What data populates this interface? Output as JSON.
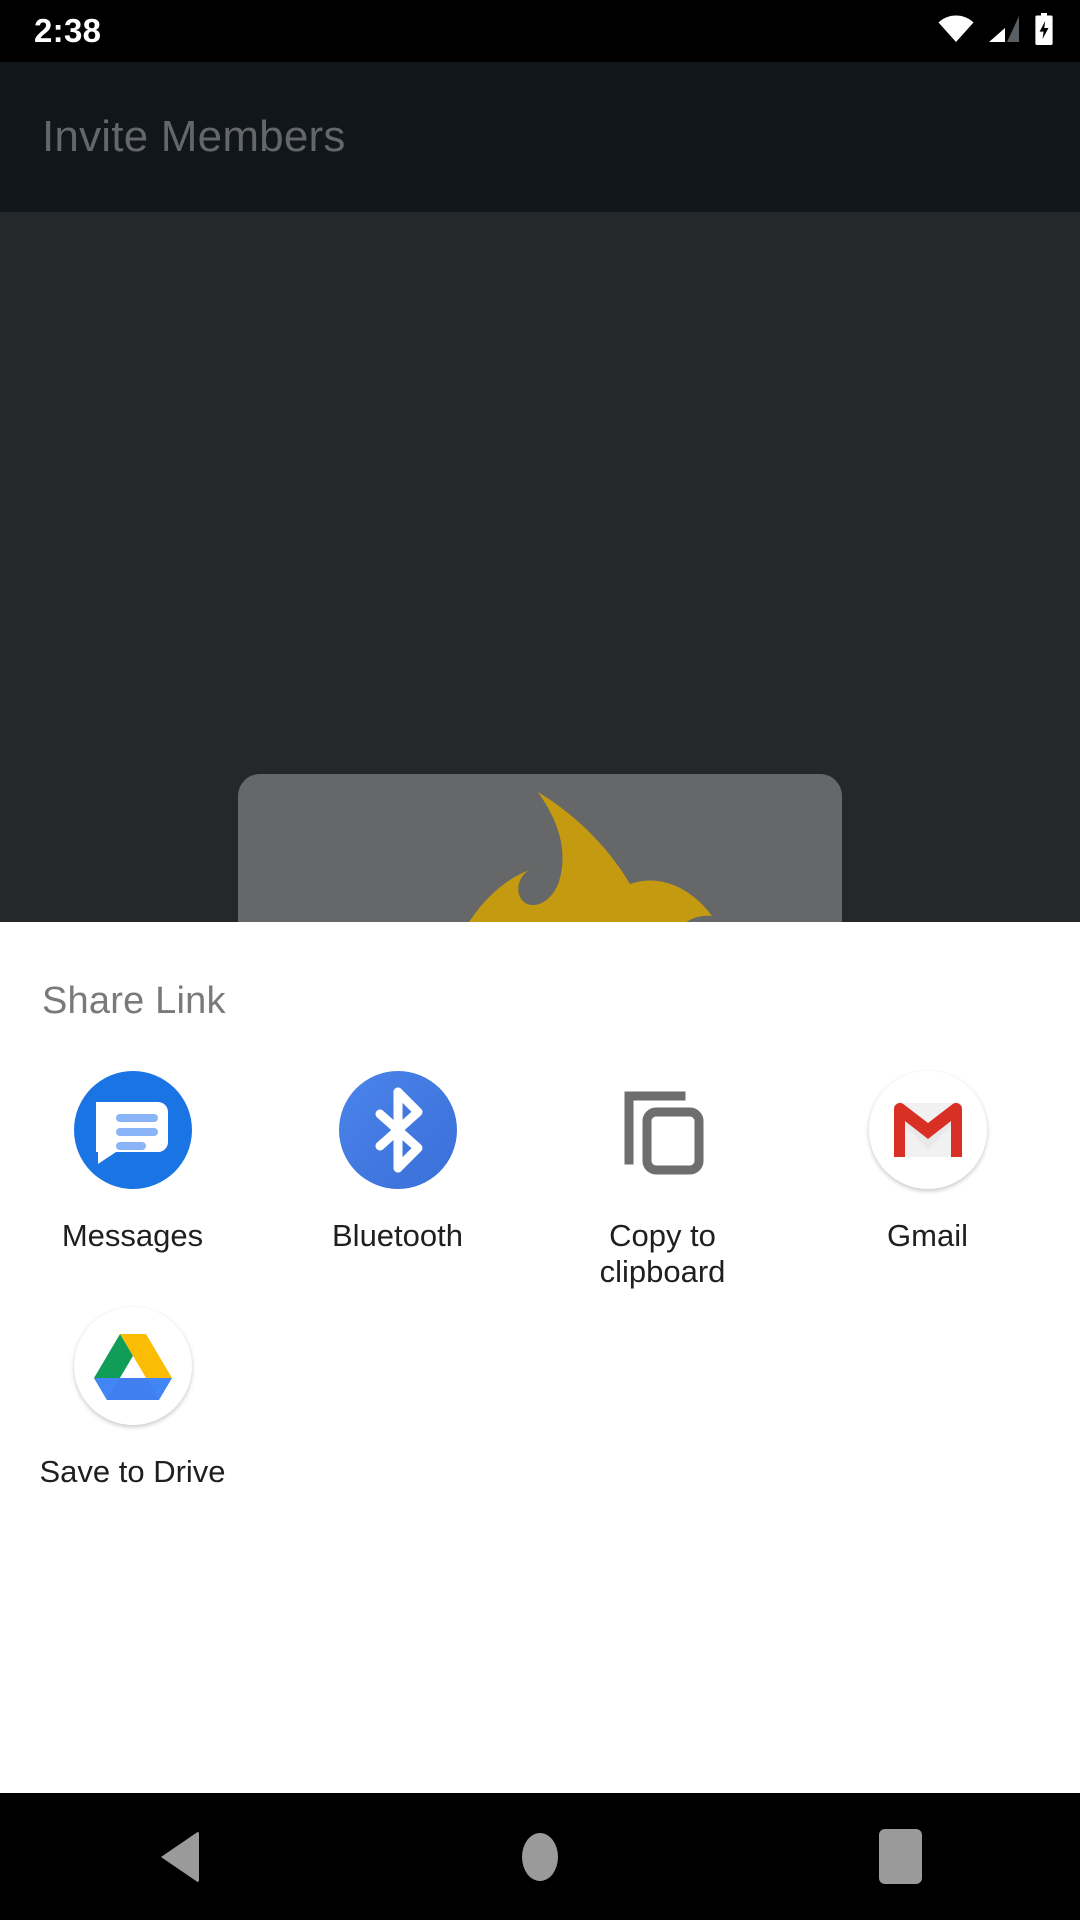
{
  "status_bar": {
    "time": "2:38",
    "icons": [
      {
        "name": "wifi-icon",
        "label": "Wi-Fi signal full"
      },
      {
        "name": "cellular-signal-icon",
        "label": "Cellular signal partial"
      },
      {
        "name": "battery-charging-icon",
        "label": "Battery charging"
      }
    ]
  },
  "app": {
    "title": "Invite Members",
    "hero_image_alt": "Yellow flame monster holding a pizza slice"
  },
  "share_sheet": {
    "title": "Share Link",
    "targets": [
      {
        "label": "Messages",
        "icon": "messages-icon"
      },
      {
        "label": "Bluetooth",
        "icon": "bluetooth-icon"
      },
      {
        "label": "Copy to clipboard",
        "icon": "copy-to-clipboard-icon"
      },
      {
        "label": "Gmail",
        "icon": "gmail-icon"
      },
      {
        "label": "Save to Drive",
        "icon": "google-drive-icon"
      }
    ]
  },
  "nav_bar": {
    "back": "Back",
    "home": "Home",
    "recents": "Recent apps"
  },
  "colors": {
    "sheet_background": "#ffffff",
    "app_background": "#25282b",
    "toolbar_background": "#11161a",
    "messages_blue": "#1b74e4",
    "bluetooth_blue": "#3f79e3",
    "gmail_red": "#d93025",
    "drive_green": "#0f9d58",
    "drive_yellow": "#fbbc04",
    "drive_blue": "#4285f4",
    "copy_gray": "#6e6e6e",
    "nav_glyph_gray": "#9a9a9a",
    "label_text": "#1f1f1f",
    "sheet_title_text": "#7a7a7a",
    "app_title_text": "#646769"
  }
}
